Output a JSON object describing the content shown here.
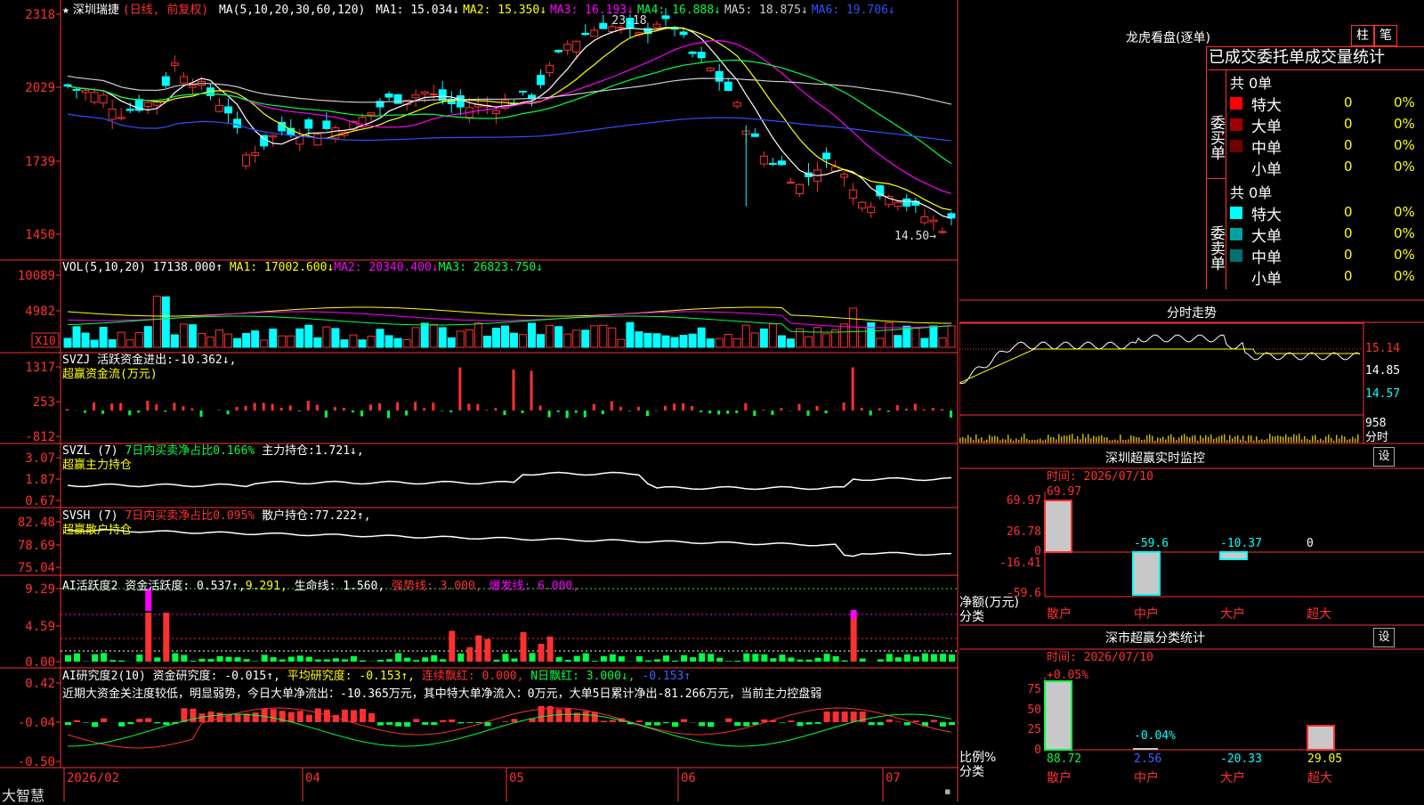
{
  "app_name": "大智慧",
  "kline": {
    "title": "深圳瑞捷",
    "mode": "(日线, 前复权)",
    "ma_label": "MA(5,10,20,30,60,120)",
    "ma": [
      {
        "name": "MA1",
        "value": "15.034↓",
        "color": "#ffffff"
      },
      {
        "name": "MA2",
        "value": "15.350↓",
        "color": "#ffff00"
      },
      {
        "name": "MA3",
        "value": "16.193↓",
        "color": "#ff00ff"
      },
      {
        "name": "MA4",
        "value": "16.888↓",
        "color": "#00ff40"
      },
      {
        "name": "MA5",
        "value": "18.875↓",
        "color": "#cccccc"
      },
      {
        "name": "MA6",
        "value": "19.706↓",
        "color": "#3050ff"
      }
    ],
    "y_ticks": [
      "2318",
      "2029",
      "1739",
      "1450"
    ],
    "high_label": "23.18",
    "low_label": "14.50→"
  },
  "vol": {
    "label": "VOL(5,10,20)",
    "value": "17138.000↑",
    "ma": [
      {
        "name": "MA1",
        "value": "17002.600↓",
        "color": "#ffff00"
      },
      {
        "name": "MA2",
        "value": "20340.400↓",
        "color": "#ff00ff"
      },
      {
        "name": "MA3",
        "value": "26823.750↓",
        "color": "#00ff40"
      }
    ],
    "y_ticks": [
      "10089",
      "4982"
    ],
    "unit": "X10"
  },
  "svzj": {
    "label": "SVZJ",
    "text": "活跃资金进出:",
    "value": "-10.362↓,",
    "sub": "超赢资金流(万元)",
    "y_ticks": [
      "1317",
      "253",
      "-812"
    ]
  },
  "svzl": {
    "label": "SVZL (7)",
    "text1": "7日内买卖净占比0.166%",
    "text2": "主力持仓:",
    "value": "1.721↓,",
    "sub": "超赢主力持仓",
    "y_ticks": [
      "3.07",
      "1.87",
      "0.67"
    ]
  },
  "svsh": {
    "label": "SVSH (7)",
    "text1": "7日内买卖净占比0.095%",
    "text2": "散户持仓:",
    "value": "77.222↑,",
    "sub": "超赢散户持仓",
    "y_ticks": [
      "82.48",
      "78.69",
      "75.04"
    ]
  },
  "ai_active": {
    "label": "AI活跃度2",
    "t1": "资金活跃度:",
    "v1": "0.537↑,",
    "v2": "9.291,",
    "t3": "生命线:",
    "v3": "1.560,",
    "t4": "强势线: 3.000,",
    "t5": "爆发线: 6.000,",
    "y_ticks": [
      "9.29",
      "4.59",
      "0.00"
    ]
  },
  "ai_research": {
    "label": "AI研究度2(10)",
    "t1": "资金研究度:",
    "v1": "-0.015↑,",
    "t2": "平均研究度:",
    "v2": "-0.153↑,",
    "t3": "连续飘红: 0.000,",
    "t4": "N日飘红: 3.000↓,",
    "v5": "-0.153↑",
    "comment": "近期大资金关注度较低，明显弱势，今日大单净流出：-10.365万元，其中特大单净流入：0万元，大单5日累计净出-81.266万元，当前主力控盘弱",
    "y_ticks": [
      "0.42",
      "-0.04",
      "-0.50"
    ]
  },
  "x_axis": [
    "2026/02",
    "04",
    "05",
    "06",
    "07"
  ],
  "dragon": {
    "title": "龙虎看盘(逐单)",
    "btn1": "柱",
    "btn2": "笔",
    "header": "已成交委托单成交量统计",
    "buy_label": "委买单",
    "sell_label": "委卖单",
    "buy_total": "共 0单",
    "sell_total": "共 0单",
    "buy_rows": [
      {
        "name": "特大",
        "count": "0",
        "pct": "0%",
        "color": "#ff0000"
      },
      {
        "name": "大单",
        "count": "0",
        "pct": "0%",
        "color": "#a00000"
      },
      {
        "name": "中单",
        "count": "0",
        "pct": "0%",
        "color": "#700000"
      },
      {
        "name": "小单",
        "count": "0",
        "pct": "0%",
        "color": "#000000"
      }
    ],
    "sell_rows": [
      {
        "name": "特大",
        "count": "0",
        "pct": "0%",
        "color": "#00ffff"
      },
      {
        "name": "大单",
        "count": "0",
        "pct": "0%",
        "color": "#00a0a0"
      },
      {
        "name": "中单",
        "count": "0",
        "pct": "0%",
        "color": "#007070"
      },
      {
        "name": "小单",
        "count": "0",
        "pct": "0%",
        "color": "#000000"
      }
    ]
  },
  "intraday": {
    "title": "分时走势",
    "y_ticks": [
      "15.14",
      "14.85",
      "14.57"
    ],
    "vol_tick": "958",
    "vol_label": "分时"
  },
  "monitor": {
    "title": "深圳超赢实时监控",
    "settings": "设",
    "time": "时间: 2026/07/10",
    "y_ticks": [
      "69.97",
      "26.78",
      "0",
      "-16.41",
      "-59.6"
    ],
    "unit": "净额(万元)",
    "axis_label": "分类",
    "bars": [
      {
        "name": "散户",
        "value": "69.97"
      },
      {
        "name": "中户",
        "value": "-59.6"
      },
      {
        "name": "大户",
        "value": "-10.37"
      },
      {
        "name": "超大",
        "value": "0"
      }
    ]
  },
  "classify": {
    "title": "深市超赢分类统计",
    "settings": "设",
    "time": "时间: 2026/07/10",
    "y_ticks": [
      "75",
      "50",
      "25",
      "0"
    ],
    "unit": "比例%",
    "axis_label": "分类",
    "top_labels": [
      "+0.05%",
      "-0.04%"
    ],
    "bars": [
      {
        "name": "散户",
        "value": "88.72"
      },
      {
        "name": "中户",
        "value": "2.56"
      },
      {
        "name": "大户",
        "value": "-20.33"
      },
      {
        "name": "超大",
        "value": "29.05"
      }
    ]
  }
}
